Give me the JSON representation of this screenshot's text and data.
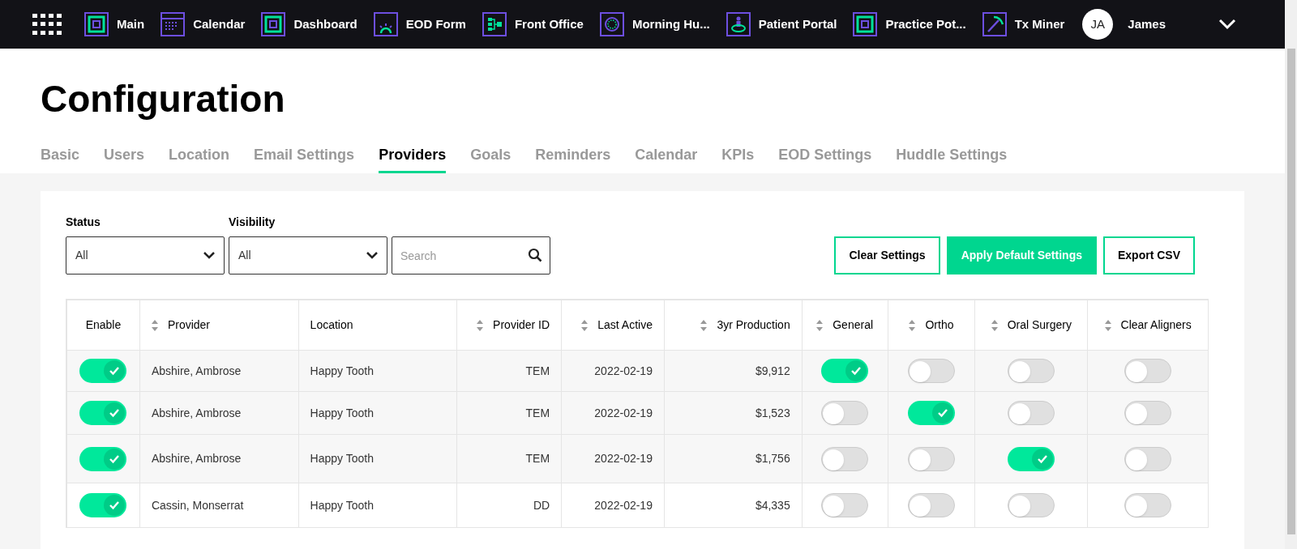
{
  "nav": {
    "items": [
      {
        "label": "Main"
      },
      {
        "label": "Calendar"
      },
      {
        "label": "Dashboard"
      },
      {
        "label": "EOD Form"
      },
      {
        "label": "Front Office"
      },
      {
        "label": "Morning Hu..."
      },
      {
        "label": "Patient Portal"
      },
      {
        "label": "Practice Pot..."
      },
      {
        "label": "Tx Miner"
      }
    ],
    "user": {
      "initials": "JA",
      "name": "James"
    }
  },
  "page": {
    "title": "Configuration"
  },
  "tabs": [
    {
      "label": "Basic",
      "selected": false
    },
    {
      "label": "Users",
      "selected": false
    },
    {
      "label": "Location",
      "selected": false
    },
    {
      "label": "Email Settings",
      "selected": false
    },
    {
      "label": "Providers",
      "selected": true
    },
    {
      "label": "Goals",
      "selected": false
    },
    {
      "label": "Reminders",
      "selected": false
    },
    {
      "label": "Calendar",
      "selected": false
    },
    {
      "label": "KPIs",
      "selected": false
    },
    {
      "label": "EOD Settings",
      "selected": false
    },
    {
      "label": "Huddle Settings",
      "selected": false
    }
  ],
  "filters": [
    {
      "label": "Status",
      "value": "All"
    },
    {
      "label": "Visibility",
      "value": "All"
    }
  ],
  "search": {
    "placeholder": "Search"
  },
  "buttons": [
    {
      "label": "Clear Settings",
      "kind": "outline"
    },
    {
      "label": "Apply Default Settings",
      "kind": "solid"
    },
    {
      "label": "Export CSV",
      "kind": "outline"
    }
  ],
  "table": {
    "columns": [
      {
        "label": "Enable",
        "sortable": false
      },
      {
        "label": "Provider",
        "sortable": true
      },
      {
        "label": "Location",
        "sortable": false
      },
      {
        "label": "Provider ID",
        "sortable": true
      },
      {
        "label": "Last Active",
        "sortable": true
      },
      {
        "label": "3yr Production",
        "sortable": true
      },
      {
        "label": "General",
        "sortable": true
      },
      {
        "label": "Ortho",
        "sortable": true
      },
      {
        "label": "Oral Surgery",
        "sortable": true
      },
      {
        "label": "Clear Aligners",
        "sortable": true
      }
    ],
    "rows": [
      {
        "enabled": true,
        "provider": "Abshire, Ambrose",
        "location": "Happy Tooth",
        "provider_id": "TEM",
        "last_active": "2022-02-19",
        "production": "$9,912",
        "general": true,
        "ortho": false,
        "oral_surgery": false,
        "clear_aligners": false
      },
      {
        "enabled": true,
        "provider": "Abshire, Ambrose",
        "location": "Happy Tooth",
        "provider_id": "TEM",
        "last_active": "2022-02-19",
        "production": "$1,523",
        "general": false,
        "ortho": true,
        "oral_surgery": false,
        "clear_aligners": false
      },
      {
        "enabled": true,
        "provider": "Abshire, Ambrose",
        "location": "Happy Tooth",
        "provider_id": "TEM",
        "last_active": "2022-02-19",
        "production": "$1,756",
        "general": false,
        "ortho": false,
        "oral_surgery": true,
        "clear_aligners": false
      },
      {
        "enabled": true,
        "provider": "Cassin, Monserrat",
        "location": "Happy Tooth",
        "provider_id": "DD",
        "last_active": "2022-02-19",
        "production": "$4,335",
        "general": false,
        "ortho": false,
        "oral_surgery": false,
        "clear_aligners": false
      }
    ]
  }
}
